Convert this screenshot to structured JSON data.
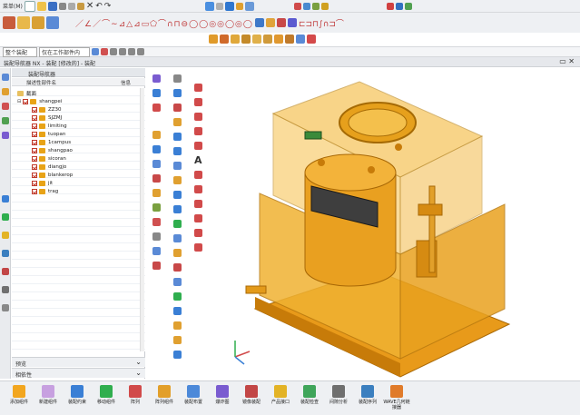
{
  "title_bar": {
    "menu_label": "菜单(M)",
    "dropdown_left": "整个装配",
    "dropdown_right": "仅在工作部件内"
  },
  "breadcrumb": "装配导航器 NX - 装配 [修改的] - 装配",
  "navigator": {
    "title": "装配导航器",
    "columns": [
      "描述性部件名",
      "信息"
    ],
    "root": "截面",
    "assembly": "shangpei",
    "parts": [
      "ZZ30",
      "SJZMJ",
      "limiting",
      "tuopan",
      "1campus",
      "shangpao",
      "sicoran",
      "diangjo",
      "blankerop",
      "jit",
      "trag"
    ],
    "footer_preview": "预览",
    "footer_dependency": "相依性"
  },
  "bottom_toolbar": [
    {
      "icon": "add-component-icon",
      "label": "添加组件",
      "color": "#f2a61f"
    },
    {
      "icon": "new-component-icon",
      "label": "新建组件",
      "color": "#c7a0e0"
    },
    {
      "icon": "assembly-constraint-icon",
      "label": "装配约束",
      "color": "#3a7fd5"
    },
    {
      "icon": "move-component-icon",
      "label": "移动组件",
      "color": "#2fae4e"
    },
    {
      "icon": "array-icon",
      "label": "阵列",
      "color": "#d14a4a"
    },
    {
      "icon": "create-array-icon",
      "label": "阵列组件",
      "color": "#e29f2a"
    },
    {
      "icon": "assembly-layout-icon",
      "label": "装配布置",
      "color": "#4c89d9"
    },
    {
      "icon": "explode-view-icon",
      "label": "爆炸图",
      "color": "#7a5cd0"
    },
    {
      "icon": "mirror-assembly-icon",
      "label": "镜像装配",
      "color": "#c24646"
    },
    {
      "icon": "wave-geometry-icon",
      "label": "产品接口",
      "color": "#e3b326"
    },
    {
      "icon": "interference-check-icon",
      "label": "装配检查",
      "color": "#3fa55a"
    },
    {
      "icon": "clearance-icon",
      "label": "间隙分析",
      "color": "#6f6f6f"
    },
    {
      "icon": "sequence-icon",
      "label": "装配序列",
      "color": "#3b7fbf"
    },
    {
      "icon": "wave-link-icon",
      "label": "WAVE几何链接器",
      "color": "#e07b2a"
    }
  ],
  "colors": {
    "part_body": "#f2a61f",
    "part_dark": "#c97a0a",
    "window_bg": "#3e3e3e",
    "window_black": "#1a1a1a"
  }
}
